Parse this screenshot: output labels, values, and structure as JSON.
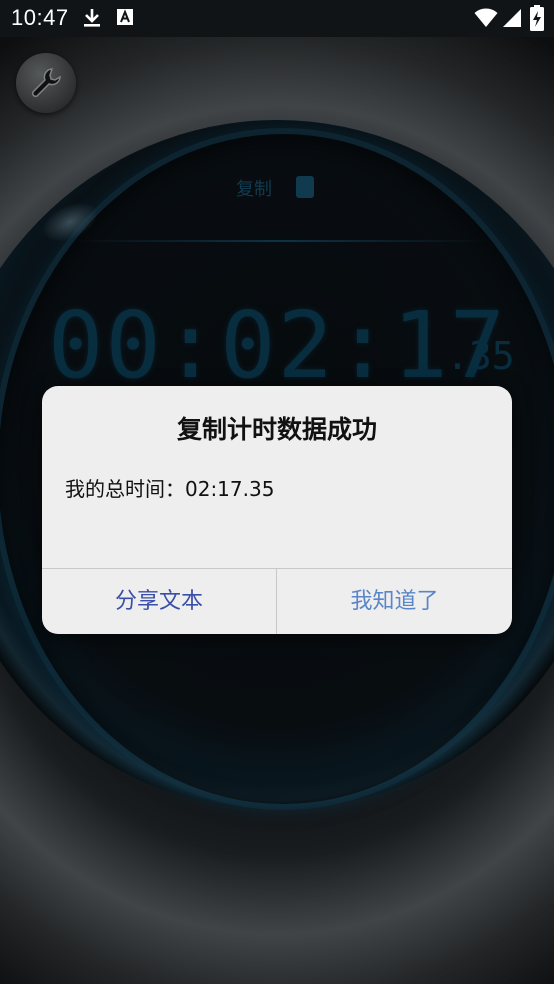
{
  "status_bar": {
    "time": "10:47",
    "download_icon": "download-icon",
    "notification_icon": "text-a-icon",
    "wifi_icon": "wifi-icon",
    "signal_icon": "signal-icon",
    "battery_icon": "battery-charging-icon"
  },
  "app": {
    "settings_icon": "wrench-icon",
    "copy_label": "复制",
    "timer_main": "00:02:17",
    "timer_fraction": ".35"
  },
  "dialog": {
    "title": "复制计时数据成功",
    "message": "我的总时间：02:17.35",
    "share_button": "分享文本",
    "ok_button": "我知道了"
  },
  "colors": {
    "lcd": "#0e4a66",
    "dialog_bg": "#eeeeef",
    "share_text": "#3a4fa8",
    "ok_text": "#5a86c8"
  }
}
